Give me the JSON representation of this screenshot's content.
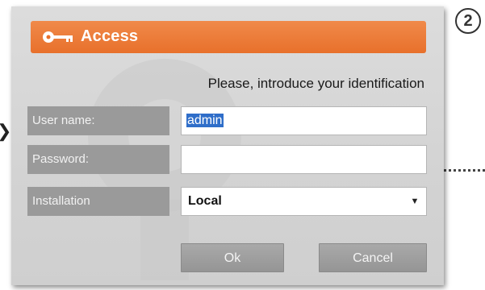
{
  "annotation": {
    "step_number": "2"
  },
  "dialog": {
    "title": "Access",
    "title_icon": "key-icon",
    "prompt": "Please, introduce your identification",
    "fields": {
      "username": {
        "label": "User name:",
        "value": "admin"
      },
      "password": {
        "label": "Password:",
        "value": ""
      },
      "installation": {
        "label": "Installation",
        "selected": "Local",
        "arrow_icon": "dropdown-arrow-icon"
      }
    },
    "buttons": {
      "ok": "Ok",
      "cancel": "Cancel"
    }
  },
  "colors": {
    "title_bar": "#e8702b",
    "label_bg": "#9a9a9a",
    "dialog_bg": "#d6d6d6",
    "selection": "#2f6ec9"
  }
}
